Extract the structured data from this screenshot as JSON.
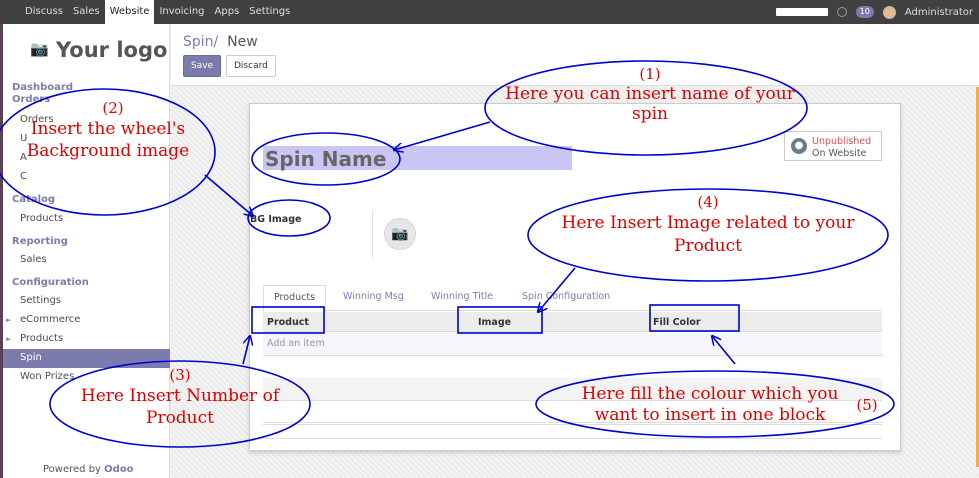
{
  "topbar": {
    "menu": [
      "Discuss",
      "Sales",
      "Website",
      "Invoicing",
      "Apps",
      "Settings"
    ],
    "active_menu": "Website",
    "chat_count": "10",
    "user": "Administrator"
  },
  "sidebar": {
    "logo_text": "Your logo",
    "sections": {
      "dashboard": "Dashboard",
      "orders": "Orders",
      "catalog": "Catalog",
      "reporting": "Reporting",
      "configuration": "Configuration"
    },
    "orders_items": [
      "Orders",
      "U",
      "A",
      "C"
    ],
    "catalog_items": [
      "Products"
    ],
    "reporting_items": [
      "Sales"
    ],
    "configuration_items": [
      "Settings",
      "eCommerce",
      "Products"
    ],
    "active_item": "Spin",
    "after_active": [
      "Won Prizes"
    ],
    "powered_by": "Powered by",
    "powered_brand": "Odoo"
  },
  "control_panel": {
    "breadcrumb_parent": "Spin",
    "breadcrumb_sep": "/",
    "breadcrumb_current": "New",
    "save": "Save",
    "discard": "Discard"
  },
  "form": {
    "name_placeholder": "Spin Name",
    "publish_status": "Unpublished",
    "publish_where": "On Website",
    "bg_label": "BG Image",
    "tabs": [
      "Products",
      "Winning Msg",
      "Winning Title",
      "Spin Configuration"
    ],
    "columns": [
      "Product",
      "Image",
      "Fill Color"
    ],
    "add_item": "Add an item"
  },
  "annotations": [
    {
      "num": "(1)",
      "text": "Here you can insert name of your spin"
    },
    {
      "num": "(2)",
      "text": "Insert the wheel's Background image"
    },
    {
      "num": "(3)",
      "text": "Here Insert Number of Product"
    },
    {
      "num": "(4)",
      "text": "Here Insert Image related to your Product"
    },
    {
      "num": "(5)",
      "text": "Here fill the colour which you want to insert in one block"
    }
  ],
  "colors": {
    "brand": "#7c7bad",
    "annotation": "#0000cc",
    "annotation_text": "#dd0000",
    "name_highlight": "#c9c5f5"
  }
}
